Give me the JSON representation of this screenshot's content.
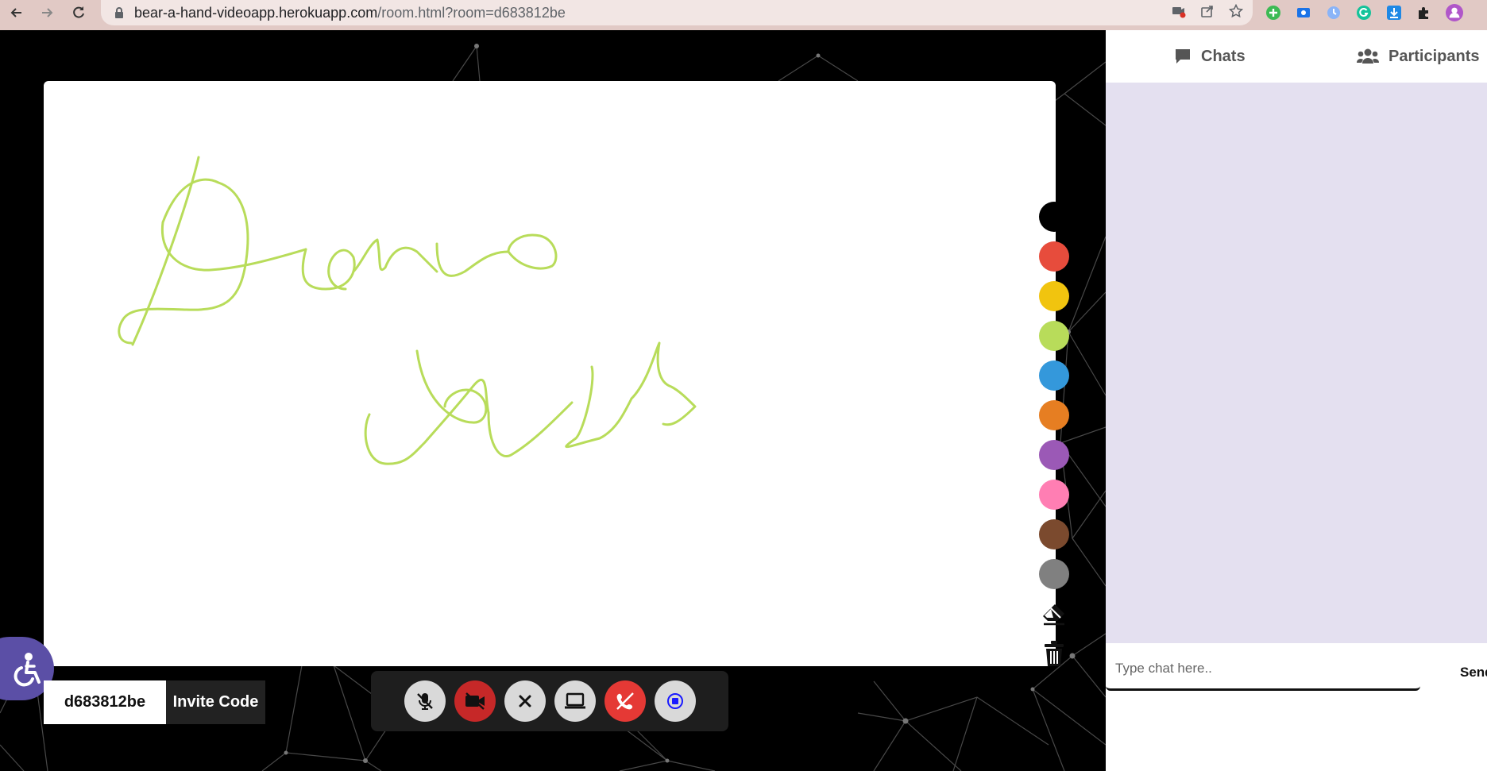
{
  "browser": {
    "url_host": "bear-a-hand-videoapp.herokuapp.com",
    "url_path": "/room.html?room=d683812be"
  },
  "whiteboard": {
    "colors": [
      "#000000",
      "#e74c3c",
      "#f1c40f",
      "#b8dc5a",
      "#3498db",
      "#e67e22",
      "#9b59b6",
      "#ff7eb3",
      "#7b4a2e",
      "#808080"
    ],
    "stroke_color": "#b8dc5a",
    "handwriting": "Demo class"
  },
  "invite": {
    "code": "d683812be",
    "button_label": "Invite Code"
  },
  "panel": {
    "chats_tab": "Chats",
    "participants_tab": "Participants",
    "chat_placeholder": "Type chat here..",
    "send_label": "Send"
  }
}
